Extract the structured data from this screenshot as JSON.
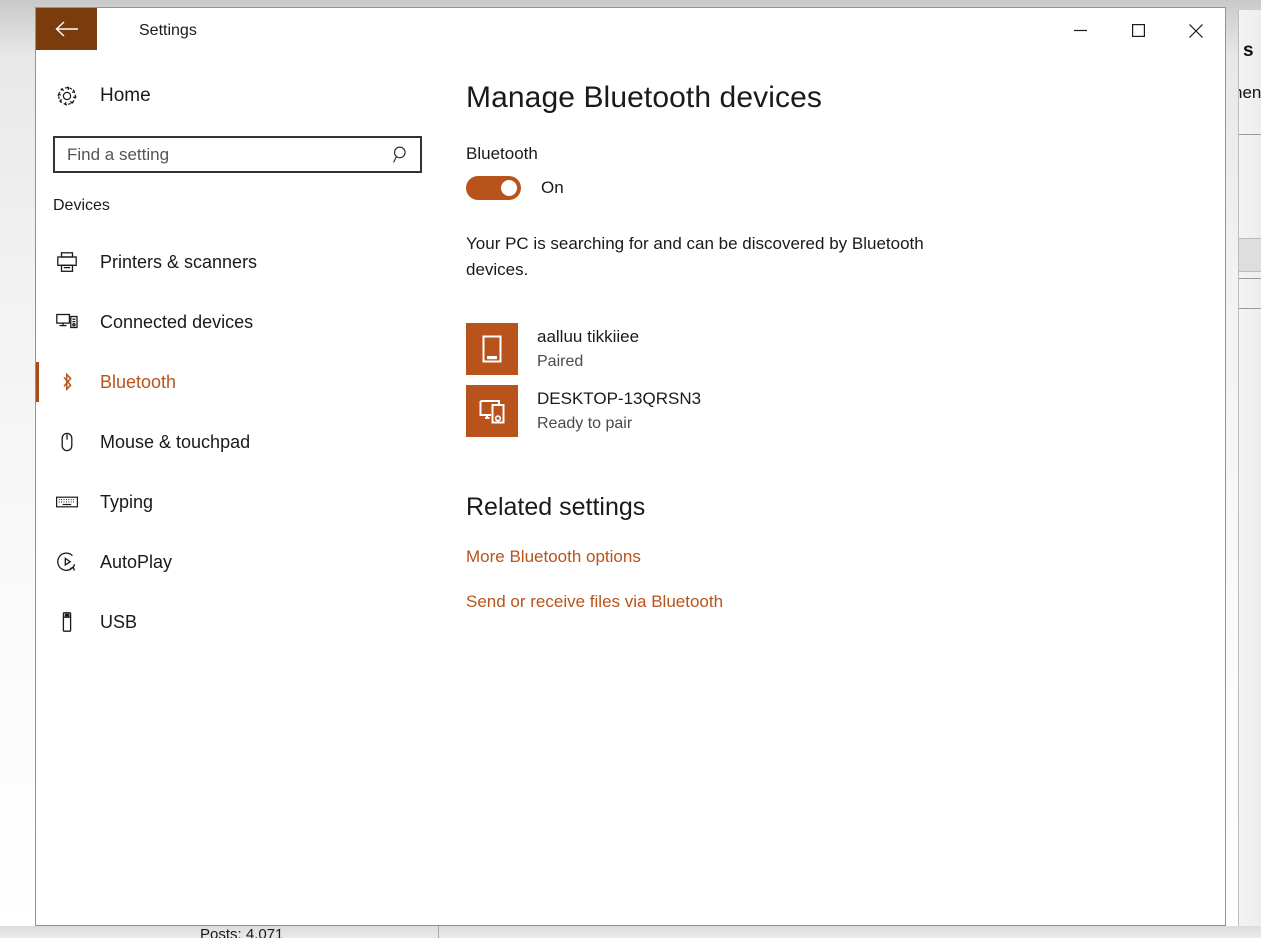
{
  "window": {
    "title": "Settings",
    "back_icon": "back-arrow-icon",
    "controls": {
      "minimize": "minimize-icon",
      "maximize": "maximize-icon",
      "close": "close-icon"
    }
  },
  "colors": {
    "accent": "#b8531b",
    "accent_dark": "#7a3c0c",
    "selection_bar": "#a8491a",
    "window_border": "#c08a4e"
  },
  "sidebar": {
    "home": {
      "label": "Home",
      "icon": "gear-icon"
    },
    "search": {
      "placeholder": "Find a setting",
      "value": "",
      "icon": "search-icon"
    },
    "group_label": "Devices",
    "items": [
      {
        "label": "Printers & scanners",
        "icon": "printer-icon",
        "active": false
      },
      {
        "label": "Connected devices",
        "icon": "connected-devices-icon",
        "active": false
      },
      {
        "label": "Bluetooth",
        "icon": "bluetooth-icon",
        "active": true
      },
      {
        "label": "Mouse & touchpad",
        "icon": "mouse-icon",
        "active": false
      },
      {
        "label": "Typing",
        "icon": "keyboard-icon",
        "active": false
      },
      {
        "label": "AutoPlay",
        "icon": "autoplay-icon",
        "active": false
      },
      {
        "label": "USB",
        "icon": "usb-icon",
        "active": false
      }
    ]
  },
  "main": {
    "page_title": "Manage Bluetooth devices",
    "bluetooth_label": "Bluetooth",
    "toggle_state": "On",
    "toggle_on": true,
    "description": "Your PC is searching for and can be discovered by Bluetooth devices.",
    "devices": [
      {
        "name": "aalluu tikkiiee",
        "status": "Paired",
        "icon": "phone-icon"
      },
      {
        "name": "DESKTOP-13QRSN3",
        "status": "Ready to pair",
        "icon": "monitor-phone-icon"
      }
    ],
    "related_settings": {
      "title": "Related settings",
      "links": [
        "More Bluetooth options",
        "Send or receive files via Bluetooth"
      ]
    }
  },
  "background": {
    "right_pane": {
      "text_1": "s",
      "text_2": "nen"
    },
    "bottom_pane": {
      "text": "Posts: 4,071"
    }
  }
}
